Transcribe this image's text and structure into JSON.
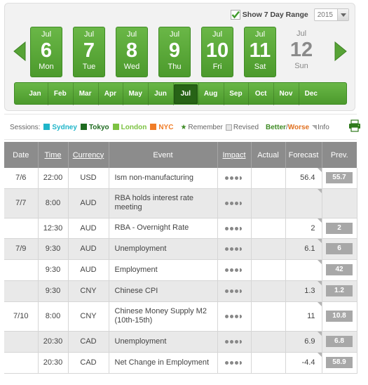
{
  "range": {
    "checkbox_checked": true,
    "label": "Show 7 Day Range",
    "year": "2015"
  },
  "days": [
    {
      "month": "Jul",
      "num": "6",
      "dow": "Mon",
      "active": true
    },
    {
      "month": "Jul",
      "num": "7",
      "dow": "Tue",
      "active": true
    },
    {
      "month": "Jul",
      "num": "8",
      "dow": "Wed",
      "active": true
    },
    {
      "month": "Jul",
      "num": "9",
      "dow": "Thu",
      "active": true
    },
    {
      "month": "Jul",
      "num": "10",
      "dow": "Fri",
      "active": true
    },
    {
      "month": "Jul",
      "num": "11",
      "dow": "Sat",
      "active": true
    },
    {
      "month": "Jul",
      "num": "12",
      "dow": "Sun",
      "active": false
    }
  ],
  "months": [
    "Jan",
    "Feb",
    "Mar",
    "Apr",
    "May",
    "Jun",
    "Jul",
    "Aug",
    "Sep",
    "Oct",
    "Nov",
    "Dec"
  ],
  "active_month": "Jul",
  "legend": {
    "sessions_label": "Sessions:",
    "sessions": [
      {
        "name": "Sydney",
        "color": "#1fb5c9"
      },
      {
        "name": "Tokyo",
        "color": "#1f6b20"
      },
      {
        "name": "London",
        "color": "#7cc242"
      },
      {
        "name": "NYC",
        "color": "#f07c27"
      }
    ],
    "remember": "Remember",
    "revised": "Revised",
    "better": "Better",
    "slash": "/",
    "worse": "Worse",
    "info": "Info"
  },
  "colors": {
    "accent_green": "#55a434",
    "header_gray": "#8c8c8c",
    "prev_box": "#a8a8a8"
  },
  "table": {
    "headers": {
      "date": "Date",
      "time": "Time",
      "currency": "Currency",
      "event": "Event",
      "impact": "Impact",
      "actual": "Actual",
      "forecast": "Forecast",
      "prev": "Prev."
    },
    "rows": [
      {
        "date": "7/6",
        "time": "22:00",
        "currency": "USD",
        "event": "Ism non-manufacturing",
        "impact_dots": 3.5,
        "actual": "",
        "forecast": "56.4",
        "prev": "55.7"
      },
      {
        "date": "7/7",
        "time": "8:00",
        "currency": "AUD",
        "event": "RBA holds interest rate meeting",
        "impact_dots": 3.5,
        "actual": "",
        "forecast": "",
        "prev": ""
      },
      {
        "date": "",
        "time": "12:30",
        "currency": "AUD",
        "event": "RBA - Overnight Rate",
        "impact_dots": 3.5,
        "actual": "",
        "forecast": "2",
        "prev": "2"
      },
      {
        "date": "7/9",
        "time": "9:30",
        "currency": "AUD",
        "event": "Unemployment",
        "impact_dots": 3.5,
        "actual": "",
        "forecast": "6.1",
        "prev": "6"
      },
      {
        "date": "",
        "time": "9:30",
        "currency": "AUD",
        "event": "Employment",
        "impact_dots": 3.5,
        "actual": "",
        "forecast": "",
        "prev": "42"
      },
      {
        "date": "",
        "time": "9:30",
        "currency": "CNY",
        "event": "Chinese CPI",
        "impact_dots": 3.5,
        "actual": "",
        "forecast": "1.3",
        "prev": "1.2"
      },
      {
        "date": "7/10",
        "time": "8:00",
        "currency": "CNY",
        "event": "Chinese Money Supply M2 (10th-15th)",
        "impact_dots": 3.5,
        "actual": "",
        "forecast": "11",
        "prev": "10.8"
      },
      {
        "date": "",
        "time": "20:30",
        "currency": "CAD",
        "event": "Unemployment",
        "impact_dots": 3.5,
        "actual": "",
        "forecast": "6.9",
        "prev": "6.8"
      },
      {
        "date": "",
        "time": "20:30",
        "currency": "CAD",
        "event": "Net Change in Employment",
        "impact_dots": 3.5,
        "actual": "",
        "forecast": "-4.4",
        "prev": "58.9"
      }
    ]
  }
}
